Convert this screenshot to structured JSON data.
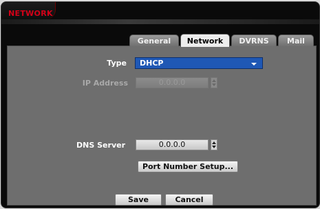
{
  "window": {
    "title": "NETWORK"
  },
  "tabs": [
    {
      "label": "General",
      "active": false
    },
    {
      "label": "Network",
      "active": true
    },
    {
      "label": "DVRNS",
      "active": false
    },
    {
      "label": "Mail",
      "active": false
    }
  ],
  "form": {
    "type": {
      "label": "Type",
      "value": "DHCP"
    },
    "ip_address": {
      "label": "IP Address",
      "value": "0.0.0.0",
      "enabled": false
    },
    "dns_server": {
      "label": "DNS Server",
      "value": "0.0.0.0"
    },
    "port_setup_button": "Port Number Setup..."
  },
  "footer": {
    "save_label": "Save",
    "cancel_label": "Cancel"
  },
  "colors": {
    "title": "#d40018",
    "select_accent": "#1f58b5",
    "panel": "#6e6e6e"
  }
}
